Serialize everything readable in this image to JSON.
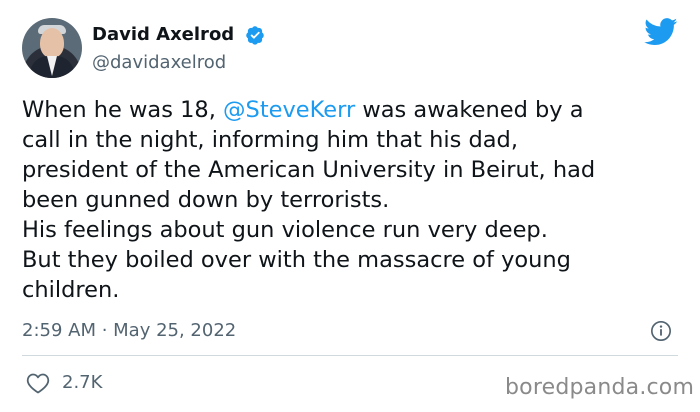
{
  "tweet": {
    "author_name": "David Axelrod",
    "author_handle": "@davidaxelrod",
    "text_before_mention": "When he was 18, ",
    "mention": "@SteveKerr",
    "text_after_mention": " was awakened by a\ncall in the night, informing him that his dad,\npresident of the American University in Beirut, had\nbeen gunned down by terrorists.\nHis feelings about gun violence run very deep.\nBut they boiled over with the massacre of young\nchildren.",
    "timestamp": "2:59 AM · May 25, 2022",
    "likes": "2.7K"
  },
  "watermark": "boredpanda.com",
  "colors": {
    "accent": "#1d9bf0",
    "text": "#0f1419",
    "secondary": "#536471",
    "divider": "#cfd9de"
  },
  "icons": [
    "verified-badge-icon",
    "twitter-bird-icon",
    "info-icon",
    "heart-icon"
  ]
}
